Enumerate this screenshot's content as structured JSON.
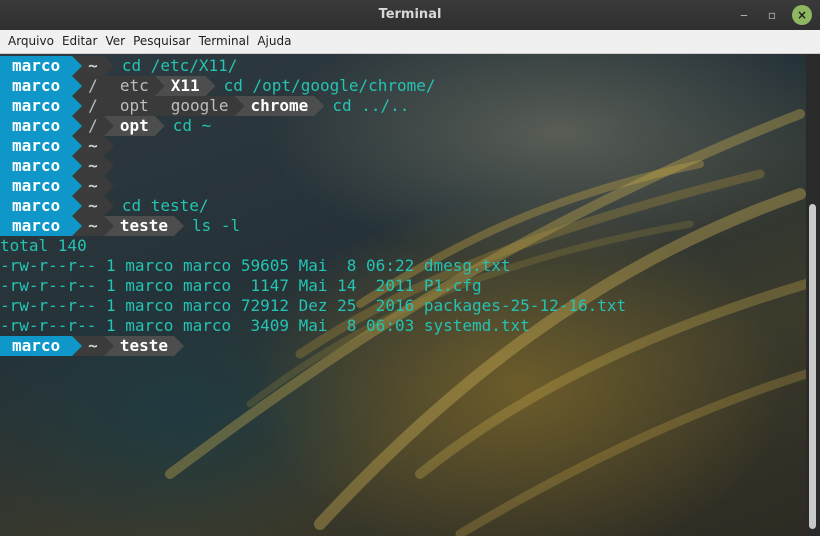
{
  "window": {
    "title": "Terminal"
  },
  "window_buttons": {
    "minimize": "‒",
    "maximize": "▫",
    "close": "×"
  },
  "menu": [
    "Arquivo",
    "Editar",
    "Ver",
    "Pesquisar",
    "Terminal",
    "Ajuda"
  ],
  "prompts": [
    {
      "user": "marco",
      "path": [
        "~"
      ],
      "command": "cd /etc/X11/"
    },
    {
      "user": "marco",
      "path": [
        "/",
        "etc",
        "X11"
      ],
      "command": "cd /opt/google/chrome/"
    },
    {
      "user": "marco",
      "path": [
        "/",
        "opt",
        "google",
        "chrome"
      ],
      "command": "cd ../.."
    },
    {
      "user": "marco",
      "path": [
        "/",
        "opt"
      ],
      "command": "cd ~"
    },
    {
      "user": "marco",
      "path": [
        "~"
      ],
      "command": ""
    },
    {
      "user": "marco",
      "path": [
        "~"
      ],
      "command": ""
    },
    {
      "user": "marco",
      "path": [
        "~"
      ],
      "command": ""
    },
    {
      "user": "marco",
      "path": [
        "~"
      ],
      "command": "cd teste/"
    },
    {
      "user": "marco",
      "path": [
        "~",
        "teste"
      ],
      "command": "ls -l"
    }
  ],
  "output": [
    "total 140",
    "-rw-r--r-- 1 marco marco 59605 Mai  8 06:22 dmesg.txt",
    "-rw-r--r-- 1 marco marco  1147 Mai 14  2011 P1.cfg",
    "-rw-r--r-- 1 marco marco 72912 Dez 25  2016 packages-25-12-16.txt",
    "-rw-r--r-- 1 marco marco  3409 Mai  8 06:03 systemd.txt"
  ],
  "final_prompt": {
    "user": "marco",
    "path": [
      "~",
      "teste"
    ],
    "command": ""
  }
}
